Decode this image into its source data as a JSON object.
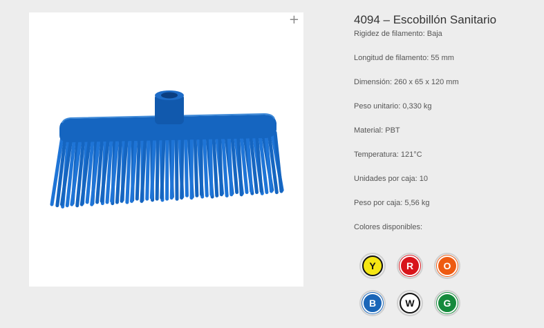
{
  "product": {
    "title": "4094 – Escobillón Sanitario",
    "specs": [
      "Rigidez de filamento: Baja",
      "Longitud de filamento: 55 mm",
      "Dimensión: 260 x 65 x 120 mm",
      "Peso unitario: 0,330 kg",
      "Material: PBT",
      "Temperatura: 121°C",
      "Unidades por caja: 10",
      "Peso por caja: 5,56 kg"
    ],
    "colors_label": "Colores disponibles:"
  },
  "image": {
    "zoom_glyph": "+",
    "product_color": "#1565c0"
  },
  "colors": [
    {
      "letter": "Y",
      "fill": "#f5e614",
      "border": "#111111",
      "text": "#111111"
    },
    {
      "letter": "R",
      "fill": "#d8141b",
      "border": "#ffffff",
      "text": "#ffffff"
    },
    {
      "letter": "O",
      "fill": "#ee5b12",
      "border": "#ffffff",
      "text": "#ffffff"
    },
    {
      "letter": "B",
      "fill": "#1a66b8",
      "border": "#ffffff",
      "text": "#ffffff"
    },
    {
      "letter": "W",
      "fill": "#ffffff",
      "border": "#111111",
      "text": "#111111"
    },
    {
      "letter": "G",
      "fill": "#158a3c",
      "border": "#ffffff",
      "text": "#ffffff"
    }
  ]
}
